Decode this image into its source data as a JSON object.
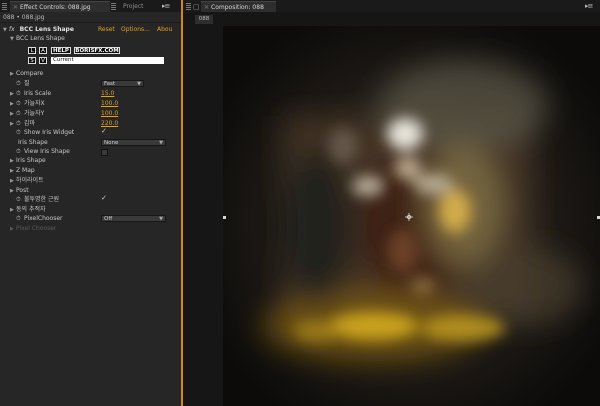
{
  "left_tabs": {
    "effect_controls": "Effect Controls: 088.jpg",
    "project": "Project"
  },
  "layer_path": "088 • 088.jpg",
  "effect": {
    "fx": "fx",
    "name": "BCC Lens Shape",
    "reset": "Reset",
    "options": "Options...",
    "about": "Abou",
    "group_label": "BCC Lens Shape",
    "toolbar": {
      "l": "L",
      "a": "A",
      "help": "HELP",
      "bfx": "BORISFX.COM",
      "s": "S",
      "v": "V"
    },
    "preset": "Current"
  },
  "params": {
    "compare": "Compare",
    "quality_label": "질",
    "quality_value": "Fast",
    "iris_scale_label": "Iris Scale",
    "iris_scale_value": "15.0",
    "width_x_label": "가늘자X",
    "width_x_value": "100.0",
    "width_y_label": "가늘자Y",
    "width_y_value": "100.0",
    "gamma_label": "감마",
    "gamma_value": "220.0",
    "show_iris_widget": "Show Iris Widget",
    "iris_shape_label": "Iris Shape",
    "iris_shape_value": "None",
    "view_iris_shape": "View Iris Shape",
    "iris_shape_group": "Iris Shape",
    "z_map": "Z Map",
    "highlights": "하이라이트",
    "post": "Post",
    "opaque_label": "불투명한 근원",
    "mix_label": "동의 추적자",
    "pixel_chooser_label": "PixelChooser",
    "pixel_chooser_value": "Off",
    "pixel_chooser_group": "Pixel Chooser"
  },
  "composition": {
    "tab": "Composition: 088",
    "badge": "088"
  },
  "colors": {
    "accent": "#e8a020",
    "divider": "#d08a18"
  }
}
